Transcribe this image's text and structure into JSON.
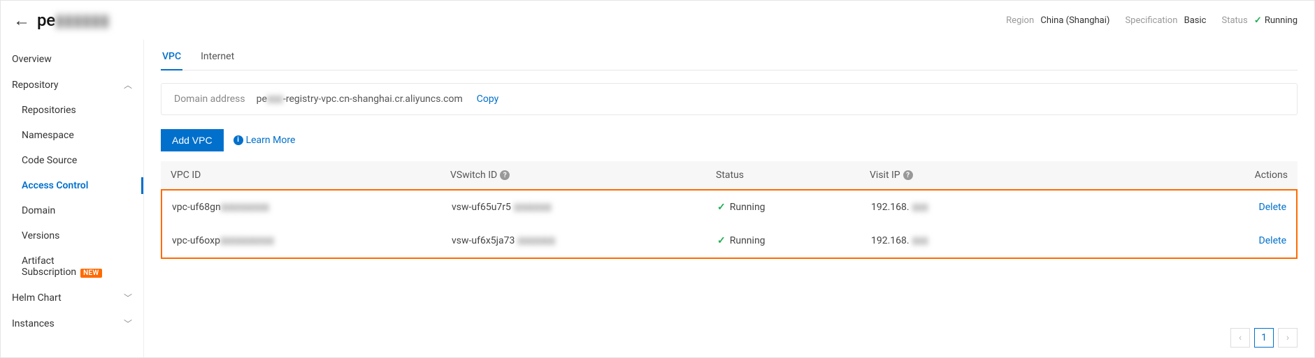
{
  "header": {
    "title_prefix": "pe",
    "title_blur": "▮▮▮▮▮▮",
    "region_label": "Region",
    "region_value": "China (Shanghai)",
    "spec_label": "Specification",
    "spec_value": "Basic",
    "status_label": "Status",
    "status_value": "Running"
  },
  "sidebar": {
    "overview": "Overview",
    "repository": "Repository",
    "repositories": "Repositories",
    "namespace": "Namespace",
    "code_source": "Code Source",
    "access_control": "Access Control",
    "domain": "Domain",
    "versions": "Versions",
    "artifact_sub": "Artifact Subscription",
    "new_badge": "NEW",
    "helm": "Helm Chart",
    "instances": "Instances"
  },
  "tabs": {
    "vpc": "VPC",
    "internet": "Internet"
  },
  "domain_box": {
    "label": "Domain address",
    "prefix": "pe",
    "blur1": "▮▮▮",
    "suffix": "-registry-vpc.cn-shanghai.cr.aliyuncs.com",
    "copy": "Copy"
  },
  "actions": {
    "add_vpc": "Add VPC",
    "learn_more": "Learn More"
  },
  "table": {
    "headers": {
      "vpc_id": "VPC ID",
      "vswitch_id": "VSwitch ID",
      "status": "Status",
      "visit_ip": "Visit IP",
      "actions": "Actions"
    },
    "rows": [
      {
        "vpc_prefix": "vpc-uf68gn",
        "vpc_blur": "▮▮▮▮▮▮▮▮▮",
        "vsw_prefix": "vsw-uf65u7r5",
        "vsw_blur": "▮▮▮▮▮▮▮",
        "status": "Running",
        "ip_prefix": "192.168.",
        "ip_blur": "▮▮▮",
        "delete": "Delete"
      },
      {
        "vpc_prefix": "vpc-uf6oxp",
        "vpc_blur": "▮▮▮▮▮▮▮▮▮▮",
        "vsw_prefix": "vsw-uf6x5ja73",
        "vsw_blur": "▮▮▮▮▮▮▮",
        "status": "Running",
        "ip_prefix": "192.168.",
        "ip_blur": "▮▮▮",
        "delete": "Delete"
      }
    ]
  },
  "pager": {
    "current": "1"
  }
}
